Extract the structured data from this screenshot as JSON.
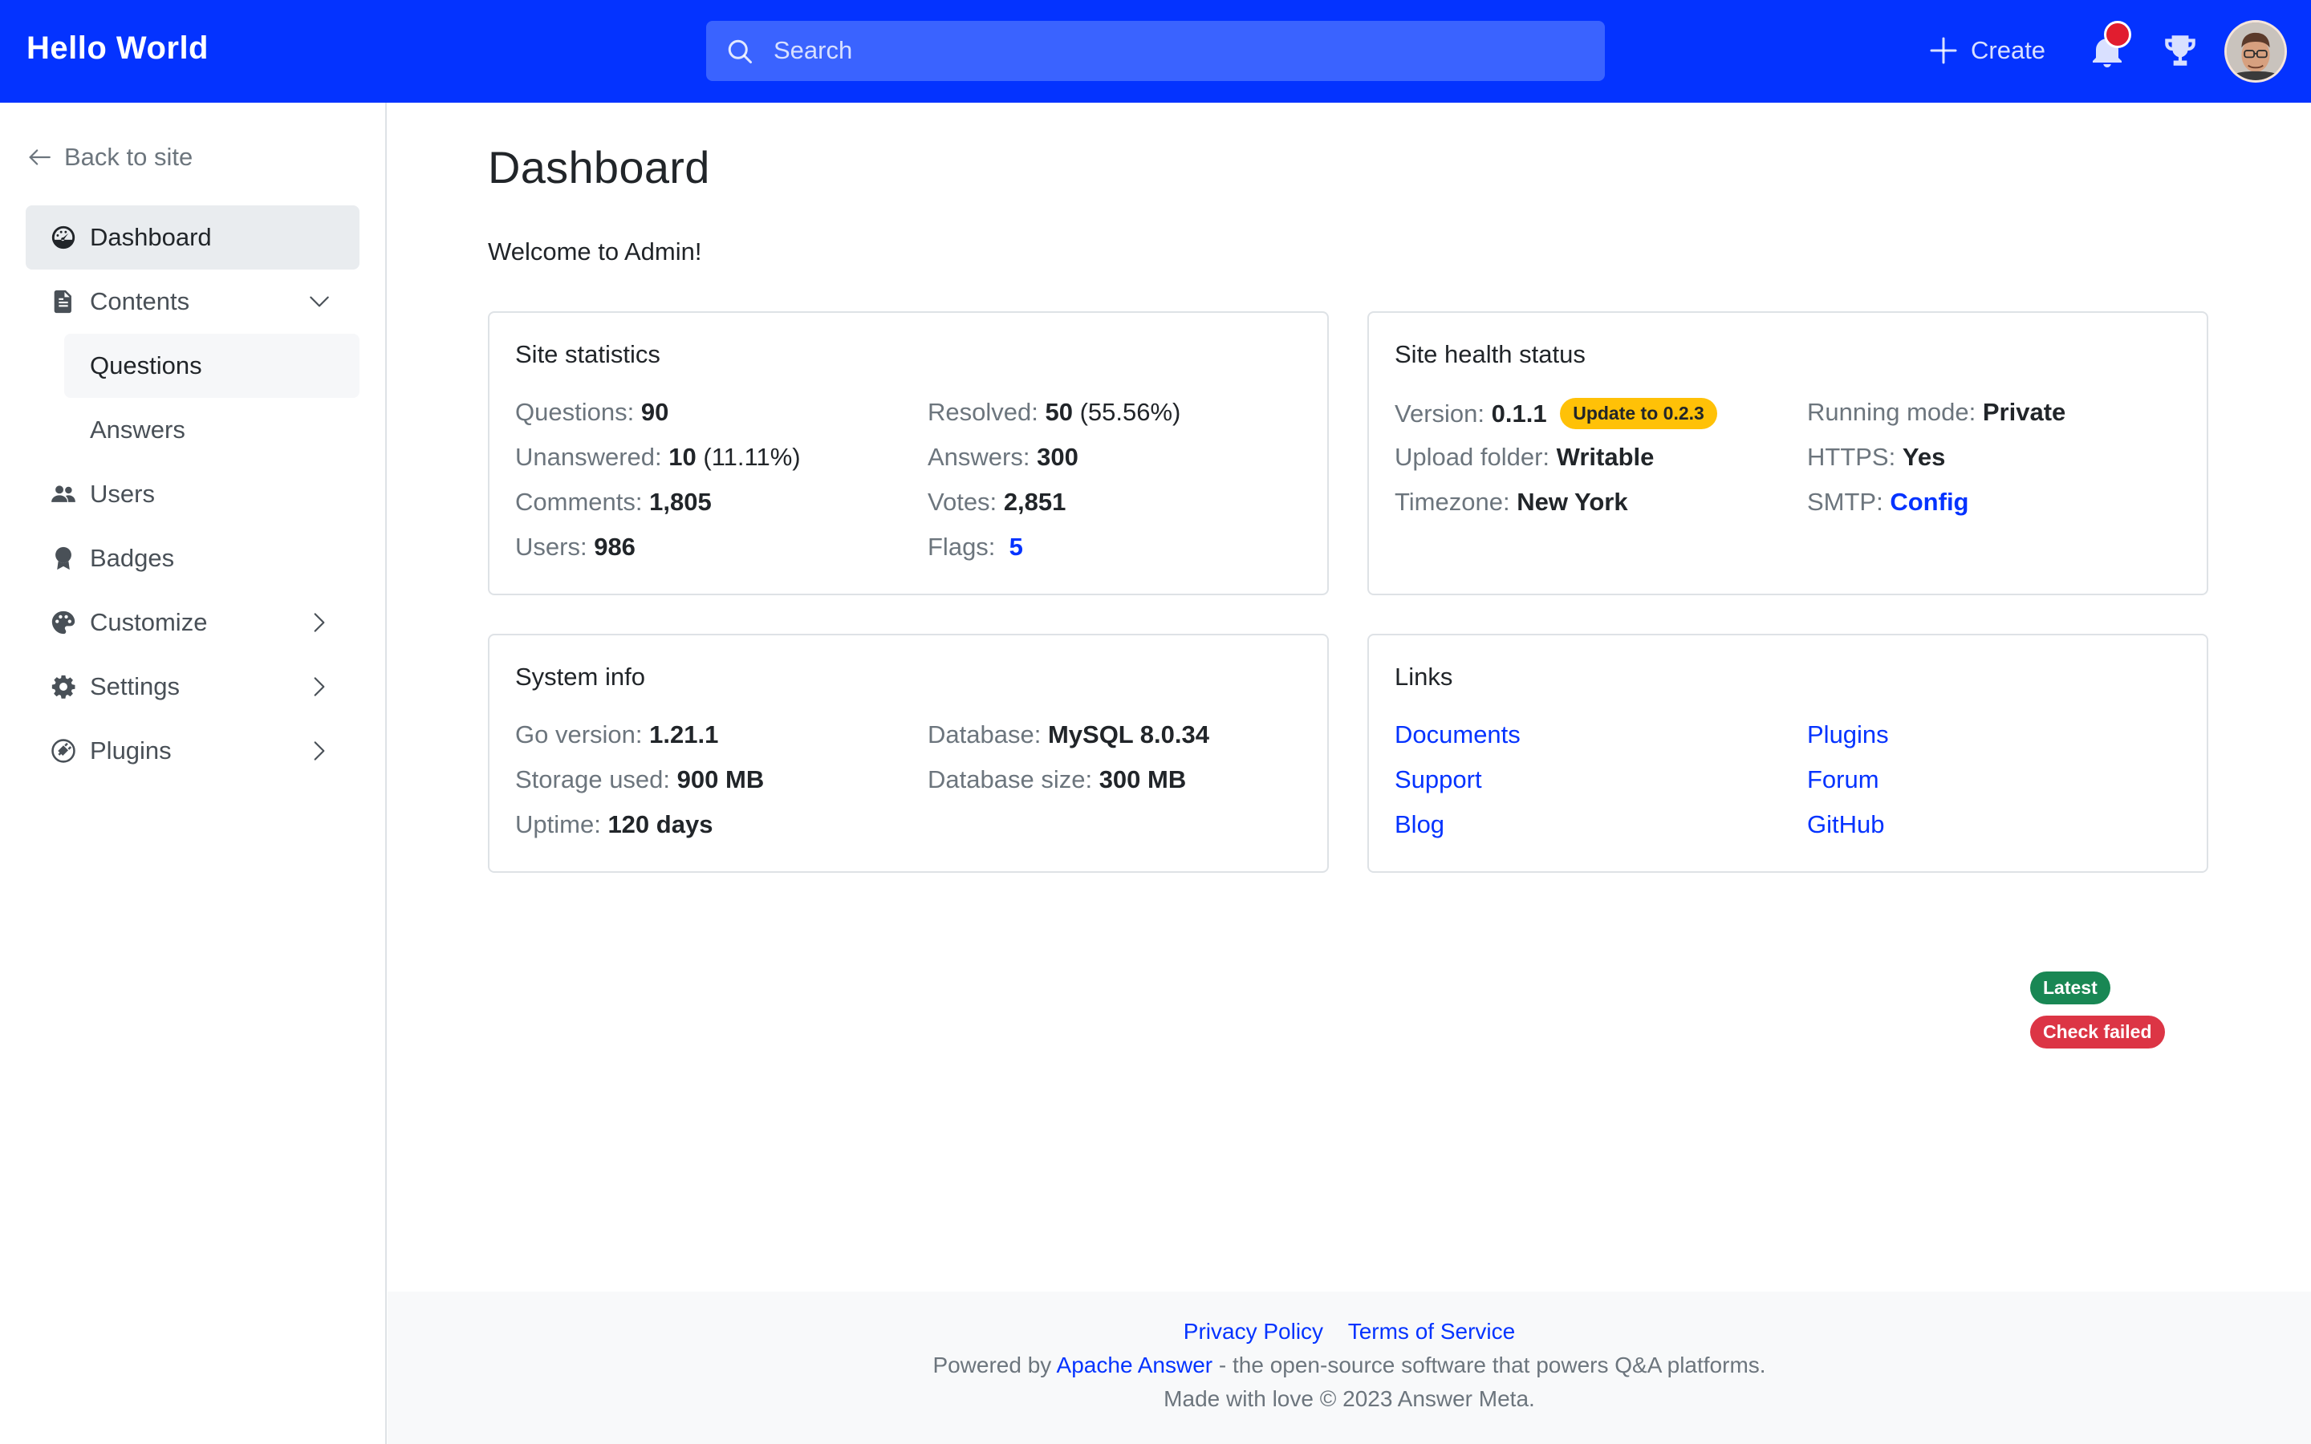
{
  "header": {
    "brand": "Hello World",
    "search_placeholder": "Search",
    "create_label": "Create",
    "accent_color": "#0433ff",
    "notification_dot_color": "#e11d2f"
  },
  "sidebar": {
    "back_label": "Back to site",
    "items": [
      {
        "label": "Dashboard",
        "icon": "dashboard-gauge-icon",
        "active": true
      },
      {
        "label": "Contents",
        "icon": "document-icon",
        "expanded": true,
        "children": [
          {
            "label": "Questions",
            "selected": true
          },
          {
            "label": "Answers"
          }
        ]
      },
      {
        "label": "Users",
        "icon": "people-icon"
      },
      {
        "label": "Badges",
        "icon": "award-icon"
      },
      {
        "label": "Customize",
        "icon": "palette-icon",
        "has_submenu": true
      },
      {
        "label": "Settings",
        "icon": "gear-icon",
        "has_submenu": true
      },
      {
        "label": "Plugins",
        "icon": "plugin-icon",
        "has_submenu": true
      }
    ]
  },
  "main": {
    "title": "Dashboard",
    "welcome": "Welcome to Admin!",
    "site_statistics": {
      "title": "Site statistics",
      "questions_label": "Questions:",
      "questions": "90",
      "unanswered_label": "Unanswered:",
      "unanswered": "10",
      "unanswered_pct": "(11.11%)",
      "comments_label": "Comments:",
      "comments": "1,805",
      "users_label": "Users:",
      "users": "986",
      "resolved_label": "Resolved:",
      "resolved": "50",
      "resolved_pct": "(55.56%)",
      "answers_label": "Answers:",
      "answers": "300",
      "votes_label": "Votes:",
      "votes": "2,851",
      "flags_label": "Flags:",
      "flags": "5"
    },
    "site_health": {
      "title": "Site health status",
      "version_label": "Version:",
      "version": "0.1.1",
      "update_badge": "Update to 0.2.3",
      "upload_label": "Upload folder:",
      "upload": "Writable",
      "timezone_label": "Timezone:",
      "timezone": "New York",
      "mode_label": "Running mode:",
      "mode": "Private",
      "https_label": "HTTPS:",
      "https": "Yes",
      "smtp_label": "SMTP:",
      "smtp": "Config"
    },
    "system_info": {
      "title": "System info",
      "go_label": "Go version:",
      "go": "1.21.1",
      "storage_label": "Storage used:",
      "storage": "900 MB",
      "uptime_label": "Uptime:",
      "uptime": "120 days",
      "database_label": "Database:",
      "database": "MySQL 8.0.34",
      "dbsize_label": "Database size:",
      "dbsize": "300 MB"
    },
    "links": {
      "title": "Links",
      "items": [
        "Documents",
        "Support",
        "Blog",
        "Plugins",
        "Forum",
        "GitHub"
      ]
    },
    "badges": {
      "latest": "Latest",
      "check_failed": "Check failed"
    }
  },
  "footer": {
    "privacy": "Privacy Policy",
    "terms": "Terms of Service",
    "powered_prefix": "Powered by",
    "powered_link": "Apache Answer",
    "powered_suffix": "- the open-source software that powers Q&A platforms.",
    "copyright": "Made with love © 2023 Answer Meta."
  }
}
